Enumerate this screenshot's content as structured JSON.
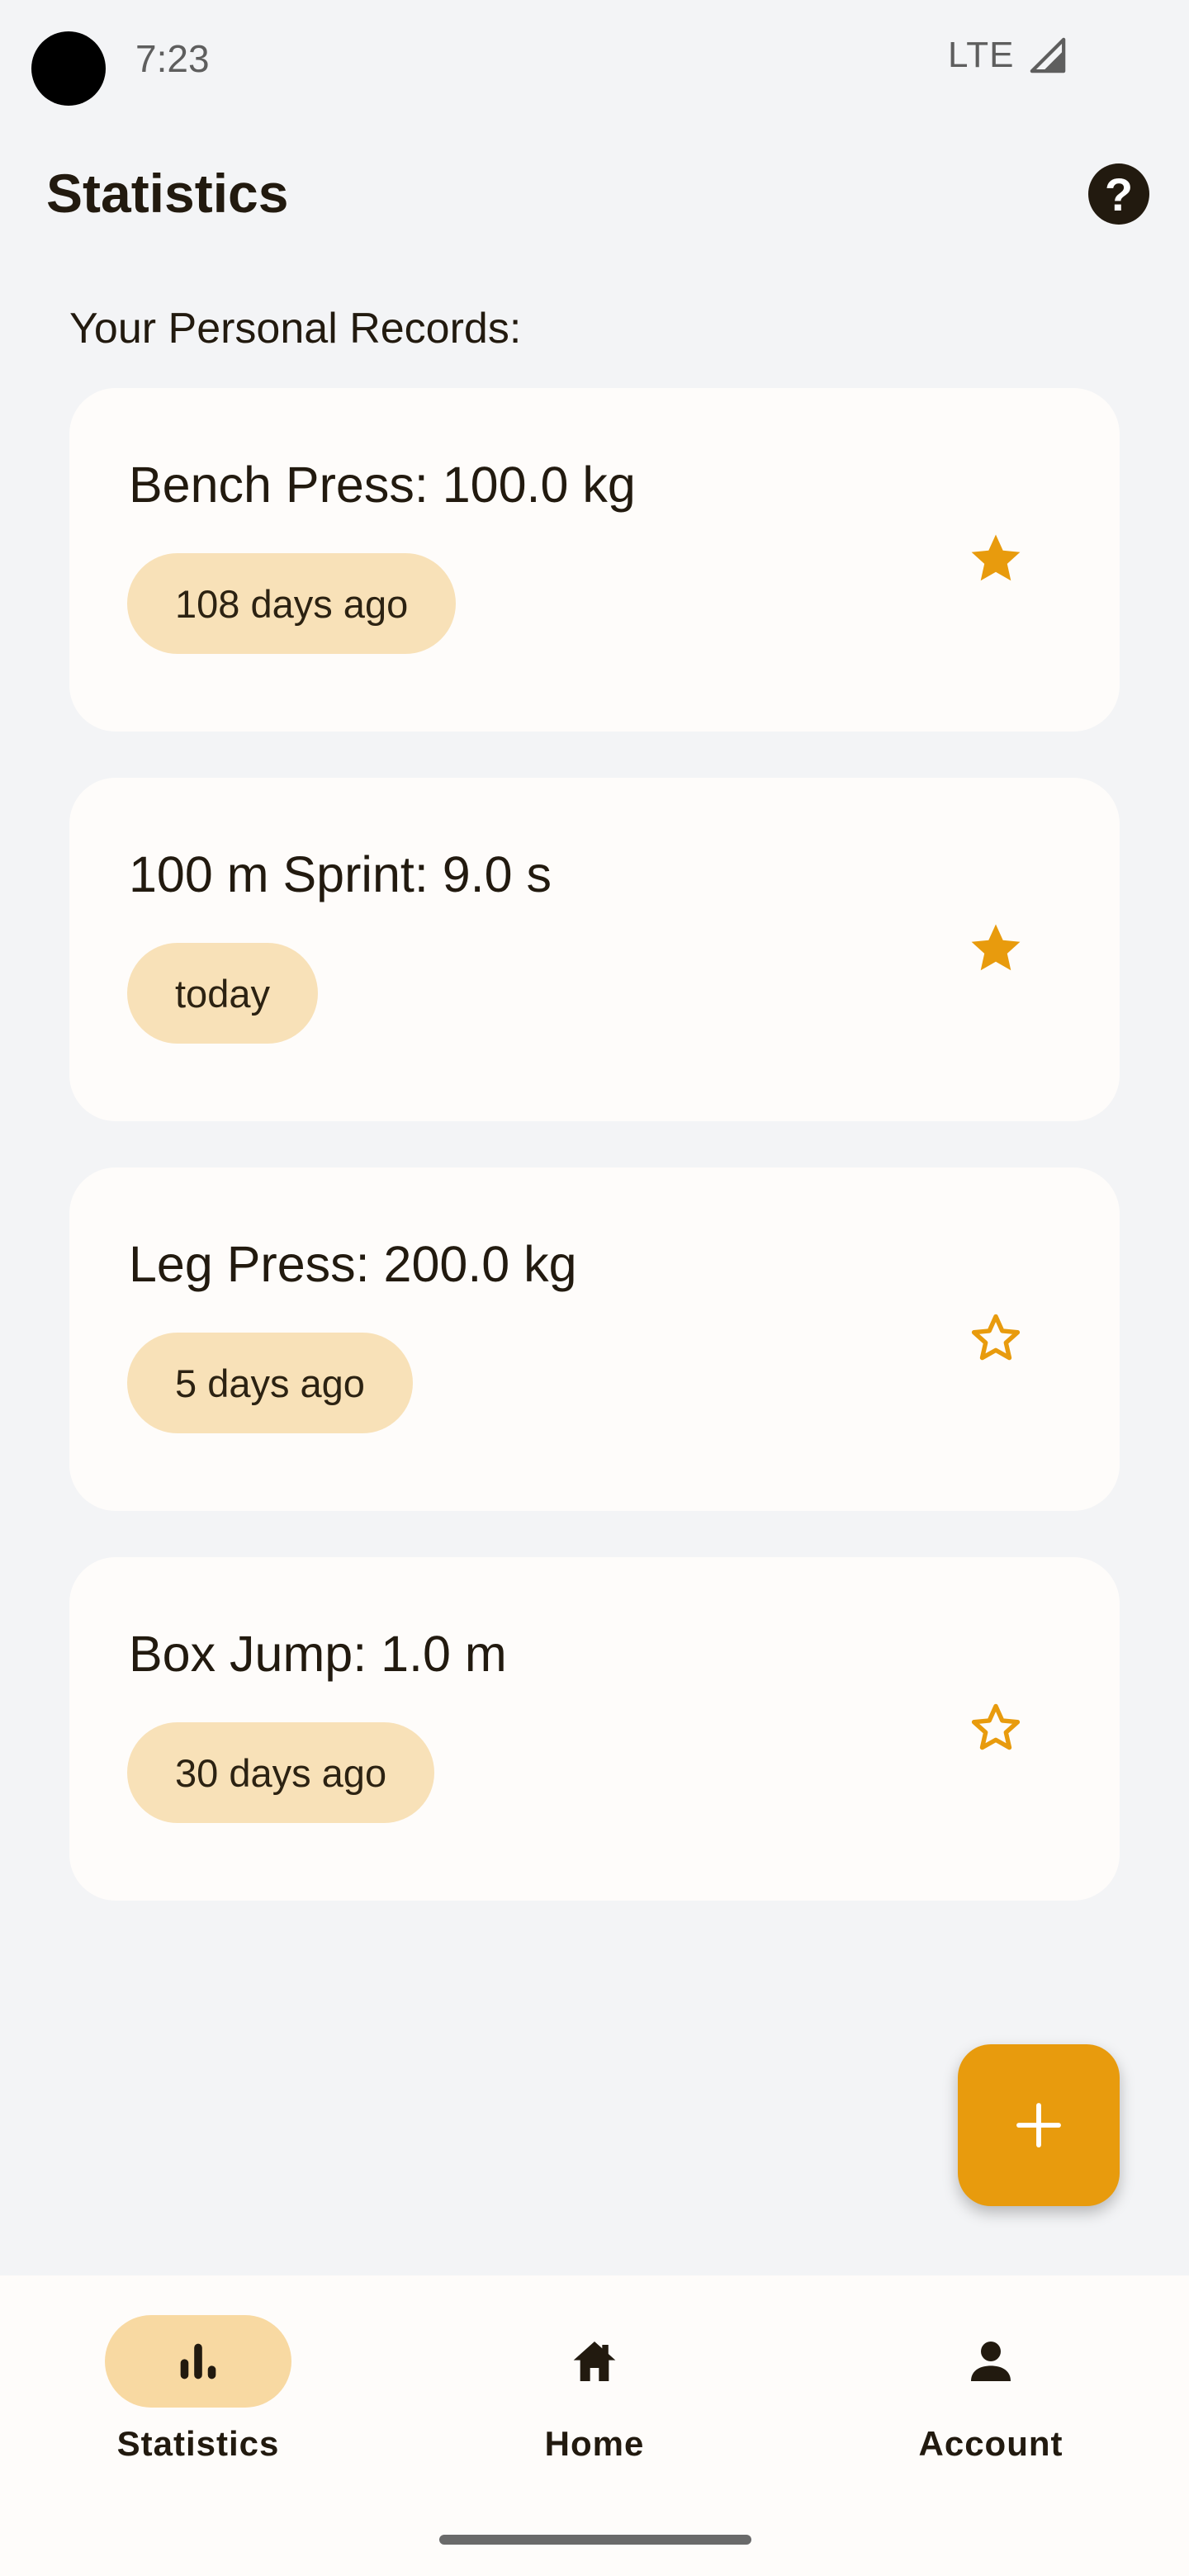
{
  "status_bar": {
    "time": "7:23",
    "network": "LTE"
  },
  "header": {
    "title": "Statistics",
    "help_icon": "help-circle-icon"
  },
  "section_label": "Your Personal Records:",
  "records": [
    {
      "title": "Bench Press: 100.0 kg",
      "date": "108 days ago",
      "starred": true
    },
    {
      "title": "100 m Sprint: 9.0 s",
      "date": "today",
      "starred": true
    },
    {
      "title": "Leg Press: 200.0 kg",
      "date": "5 days ago",
      "starred": false
    },
    {
      "title": "Box Jump: 1.0 m",
      "date": "30 days ago",
      "starred": false
    }
  ],
  "fab_icon": "plus-icon",
  "bottom_nav": [
    {
      "label": "Statistics",
      "icon": "bar-chart-icon",
      "active": true
    },
    {
      "label": "Home",
      "icon": "home-icon",
      "active": false
    },
    {
      "label": "Account",
      "icon": "person-icon",
      "active": false
    }
  ],
  "colors": {
    "background": "#f3f4f6",
    "card": "#fefcfa",
    "chip": "#f8e1b8",
    "accent": "#e89b0d",
    "text": "#221a0f",
    "nav_active_pill": "#f8d9a2"
  }
}
